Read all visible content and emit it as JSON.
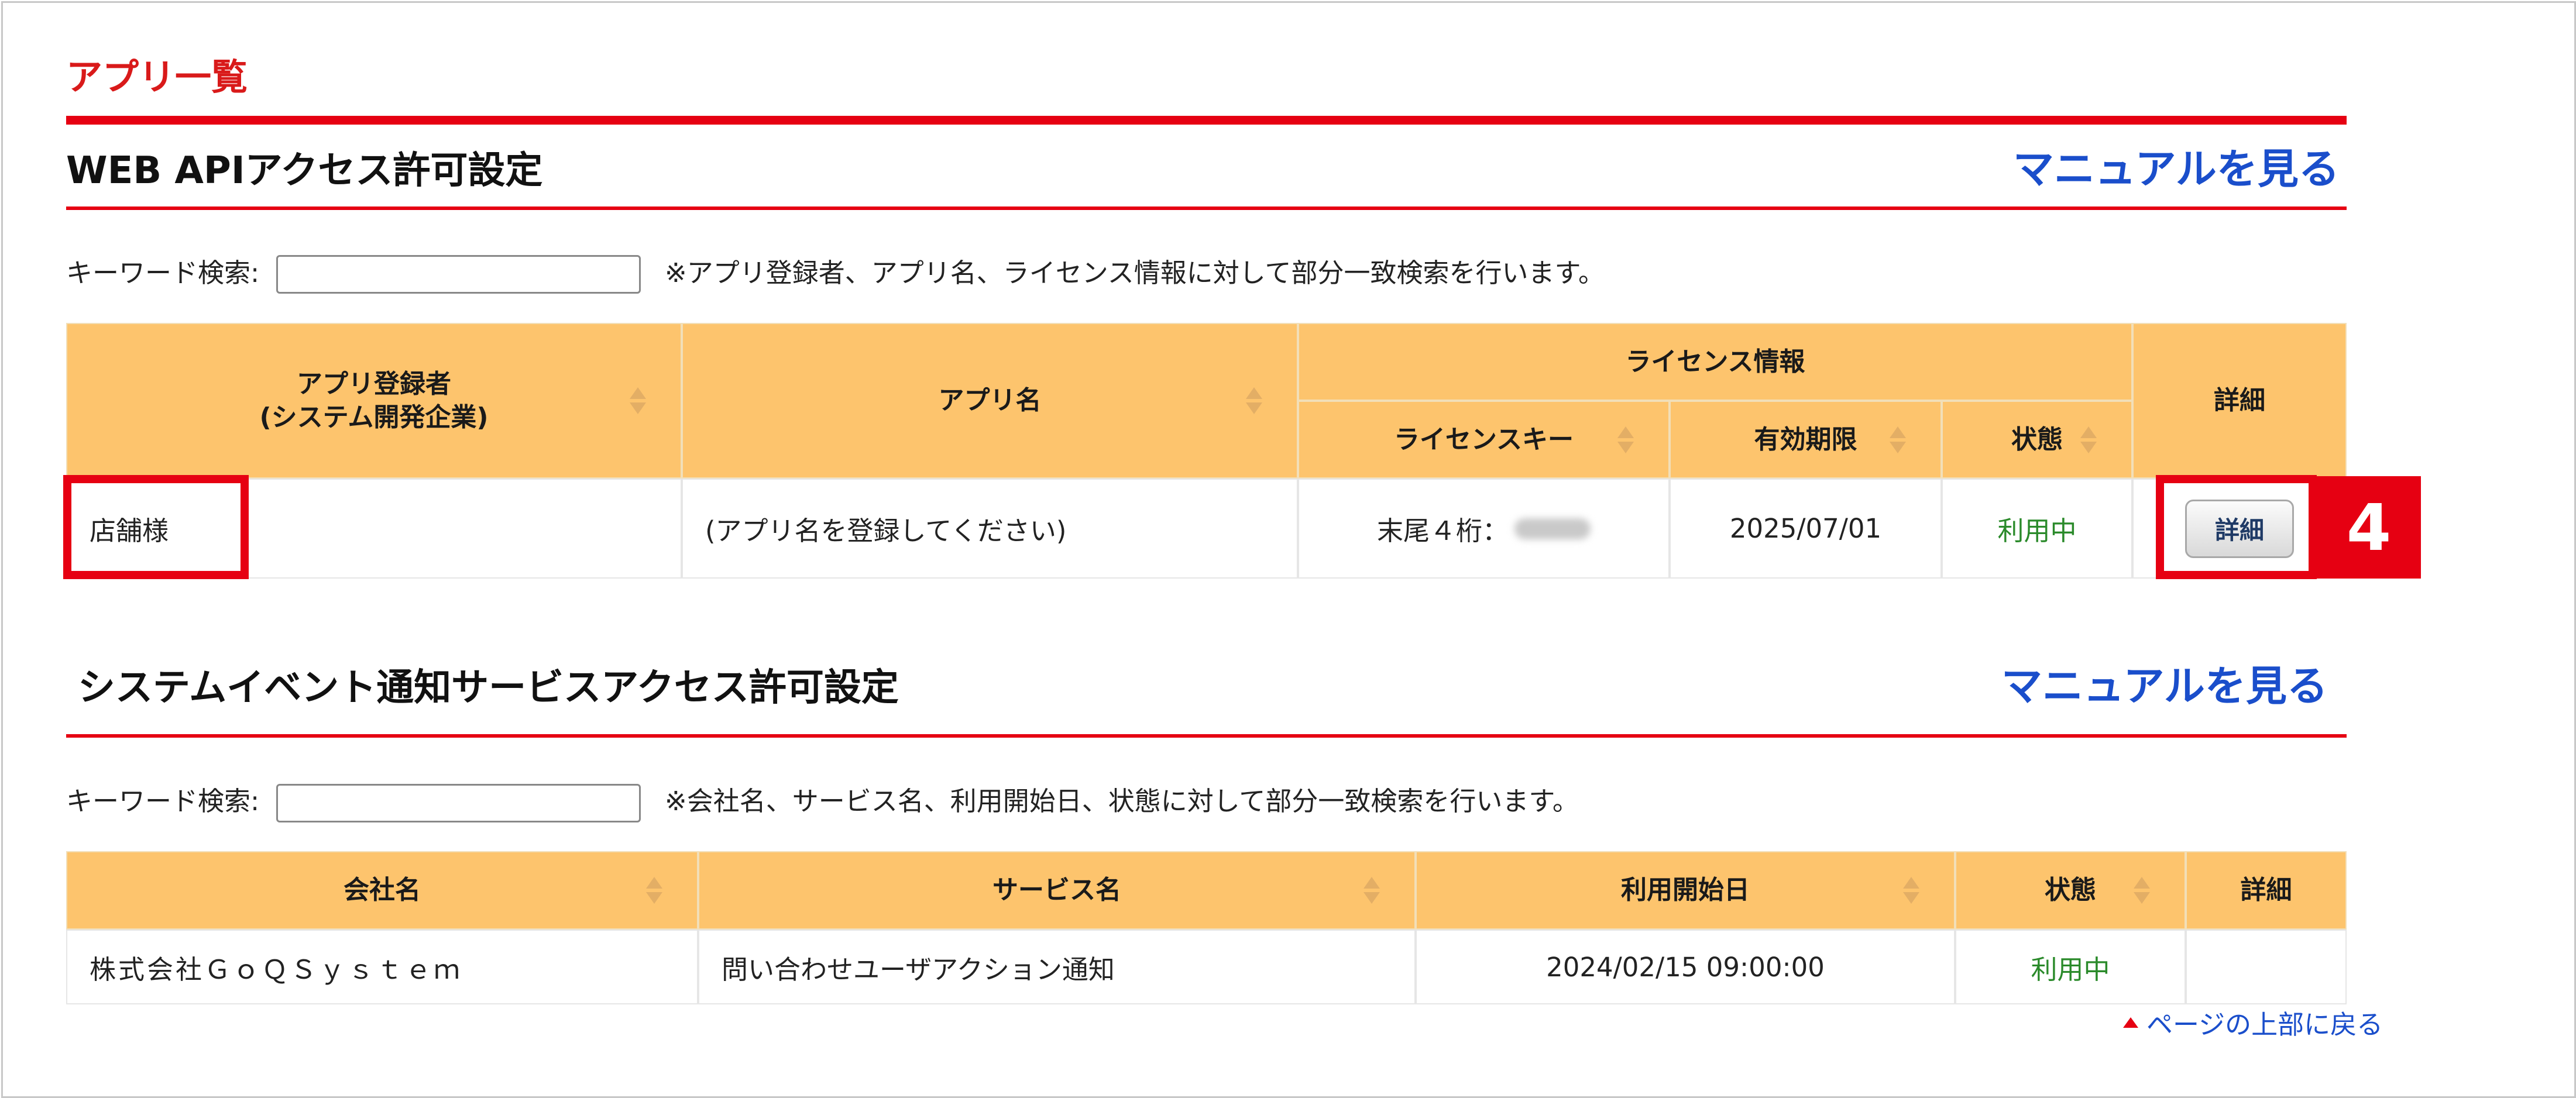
{
  "page": {
    "title": "アプリ一覧"
  },
  "web_api": {
    "title": "WEB APIアクセス許可設定",
    "manual_link": "マニュアルを見る",
    "search": {
      "label": "キーワード検索:",
      "value": "",
      "note": "※アプリ登録者、アプリ名、ライセンス情報に対して部分一致検索を行います。"
    },
    "headers": {
      "registrant": "アプリ登録者\n(システム開発企業)",
      "app_name": "アプリ名",
      "license_info": "ライセンス情報",
      "license_key": "ライセンスキー",
      "expiry": "有効期限",
      "status": "状態",
      "detail": "詳細"
    },
    "rows": [
      {
        "registrant": "店舗様",
        "app_name": "(アプリ名を登録してください)",
        "license_key_prefix": "末尾４桁：",
        "expiry": "2025/07/01",
        "status": "利用中",
        "detail_button": "詳細"
      }
    ]
  },
  "annotation": {
    "step_number": "4",
    "highlight_color": "#e60012"
  },
  "event_notify": {
    "title": "システムイベント通知サービスアクセス許可設定",
    "manual_link": "マニュアルを見る",
    "search": {
      "label": "キーワード検索:",
      "value": "",
      "note": "※会社名、サービス名、利用開始日、状態に対して部分一致検索を行います。"
    },
    "headers": {
      "company": "会社名",
      "service": "サービス名",
      "start_date": "利用開始日",
      "status": "状態",
      "detail": "詳細"
    },
    "rows": [
      {
        "company": "株式会社ＧｏＱＳｙｓｔｅｍ",
        "service": "問い合わせユーザアクション通知",
        "start_date": "2024/02/15 09:00:00",
        "status": "利用中",
        "detail": ""
      }
    ]
  },
  "footer": {
    "back_to_top": "ページの上部に戻る"
  },
  "colors": {
    "accent_red": "#e60012",
    "header_orange": "#fdc46d",
    "link_blue": "#1a4ecb",
    "status_green": "#2a8a2a"
  }
}
